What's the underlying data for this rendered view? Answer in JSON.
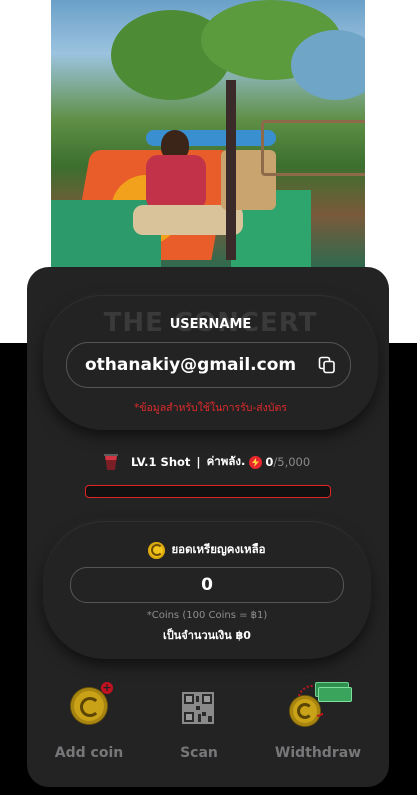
{
  "profile": {
    "banner_text": "THE CONCERT",
    "username_label": "USERNAME",
    "email": "othanakiy@gmail.com",
    "note": "*ข้อมูลสำหรับใช้ในการรับ-ส่งบัตร"
  },
  "level": {
    "label": "LV.1 Shot",
    "separator": "|",
    "energy_label": "ค่าพลัง.",
    "energy_value": "0",
    "energy_max": "/5,000",
    "progress": 0
  },
  "coins": {
    "title": "ยอดเหรียญคงเหลือ",
    "balance": "0",
    "rate_note": "*Coins (100 Coins = ฿1)",
    "money_text": "เป็นจำนวนเงิน ฿0"
  },
  "actions": {
    "add_coin": "Add coin",
    "scan": "Scan",
    "withdraw": "Widthdraw"
  },
  "colors": {
    "card": "#232324",
    "accent_red": "#e02424",
    "coin_gold": "#f2c31a"
  },
  "icons": [
    "copy-icon",
    "cup-icon",
    "bolt-icon",
    "coin-icon",
    "add-coin-icon",
    "qr-code-icon",
    "withdraw-money-icon"
  ]
}
